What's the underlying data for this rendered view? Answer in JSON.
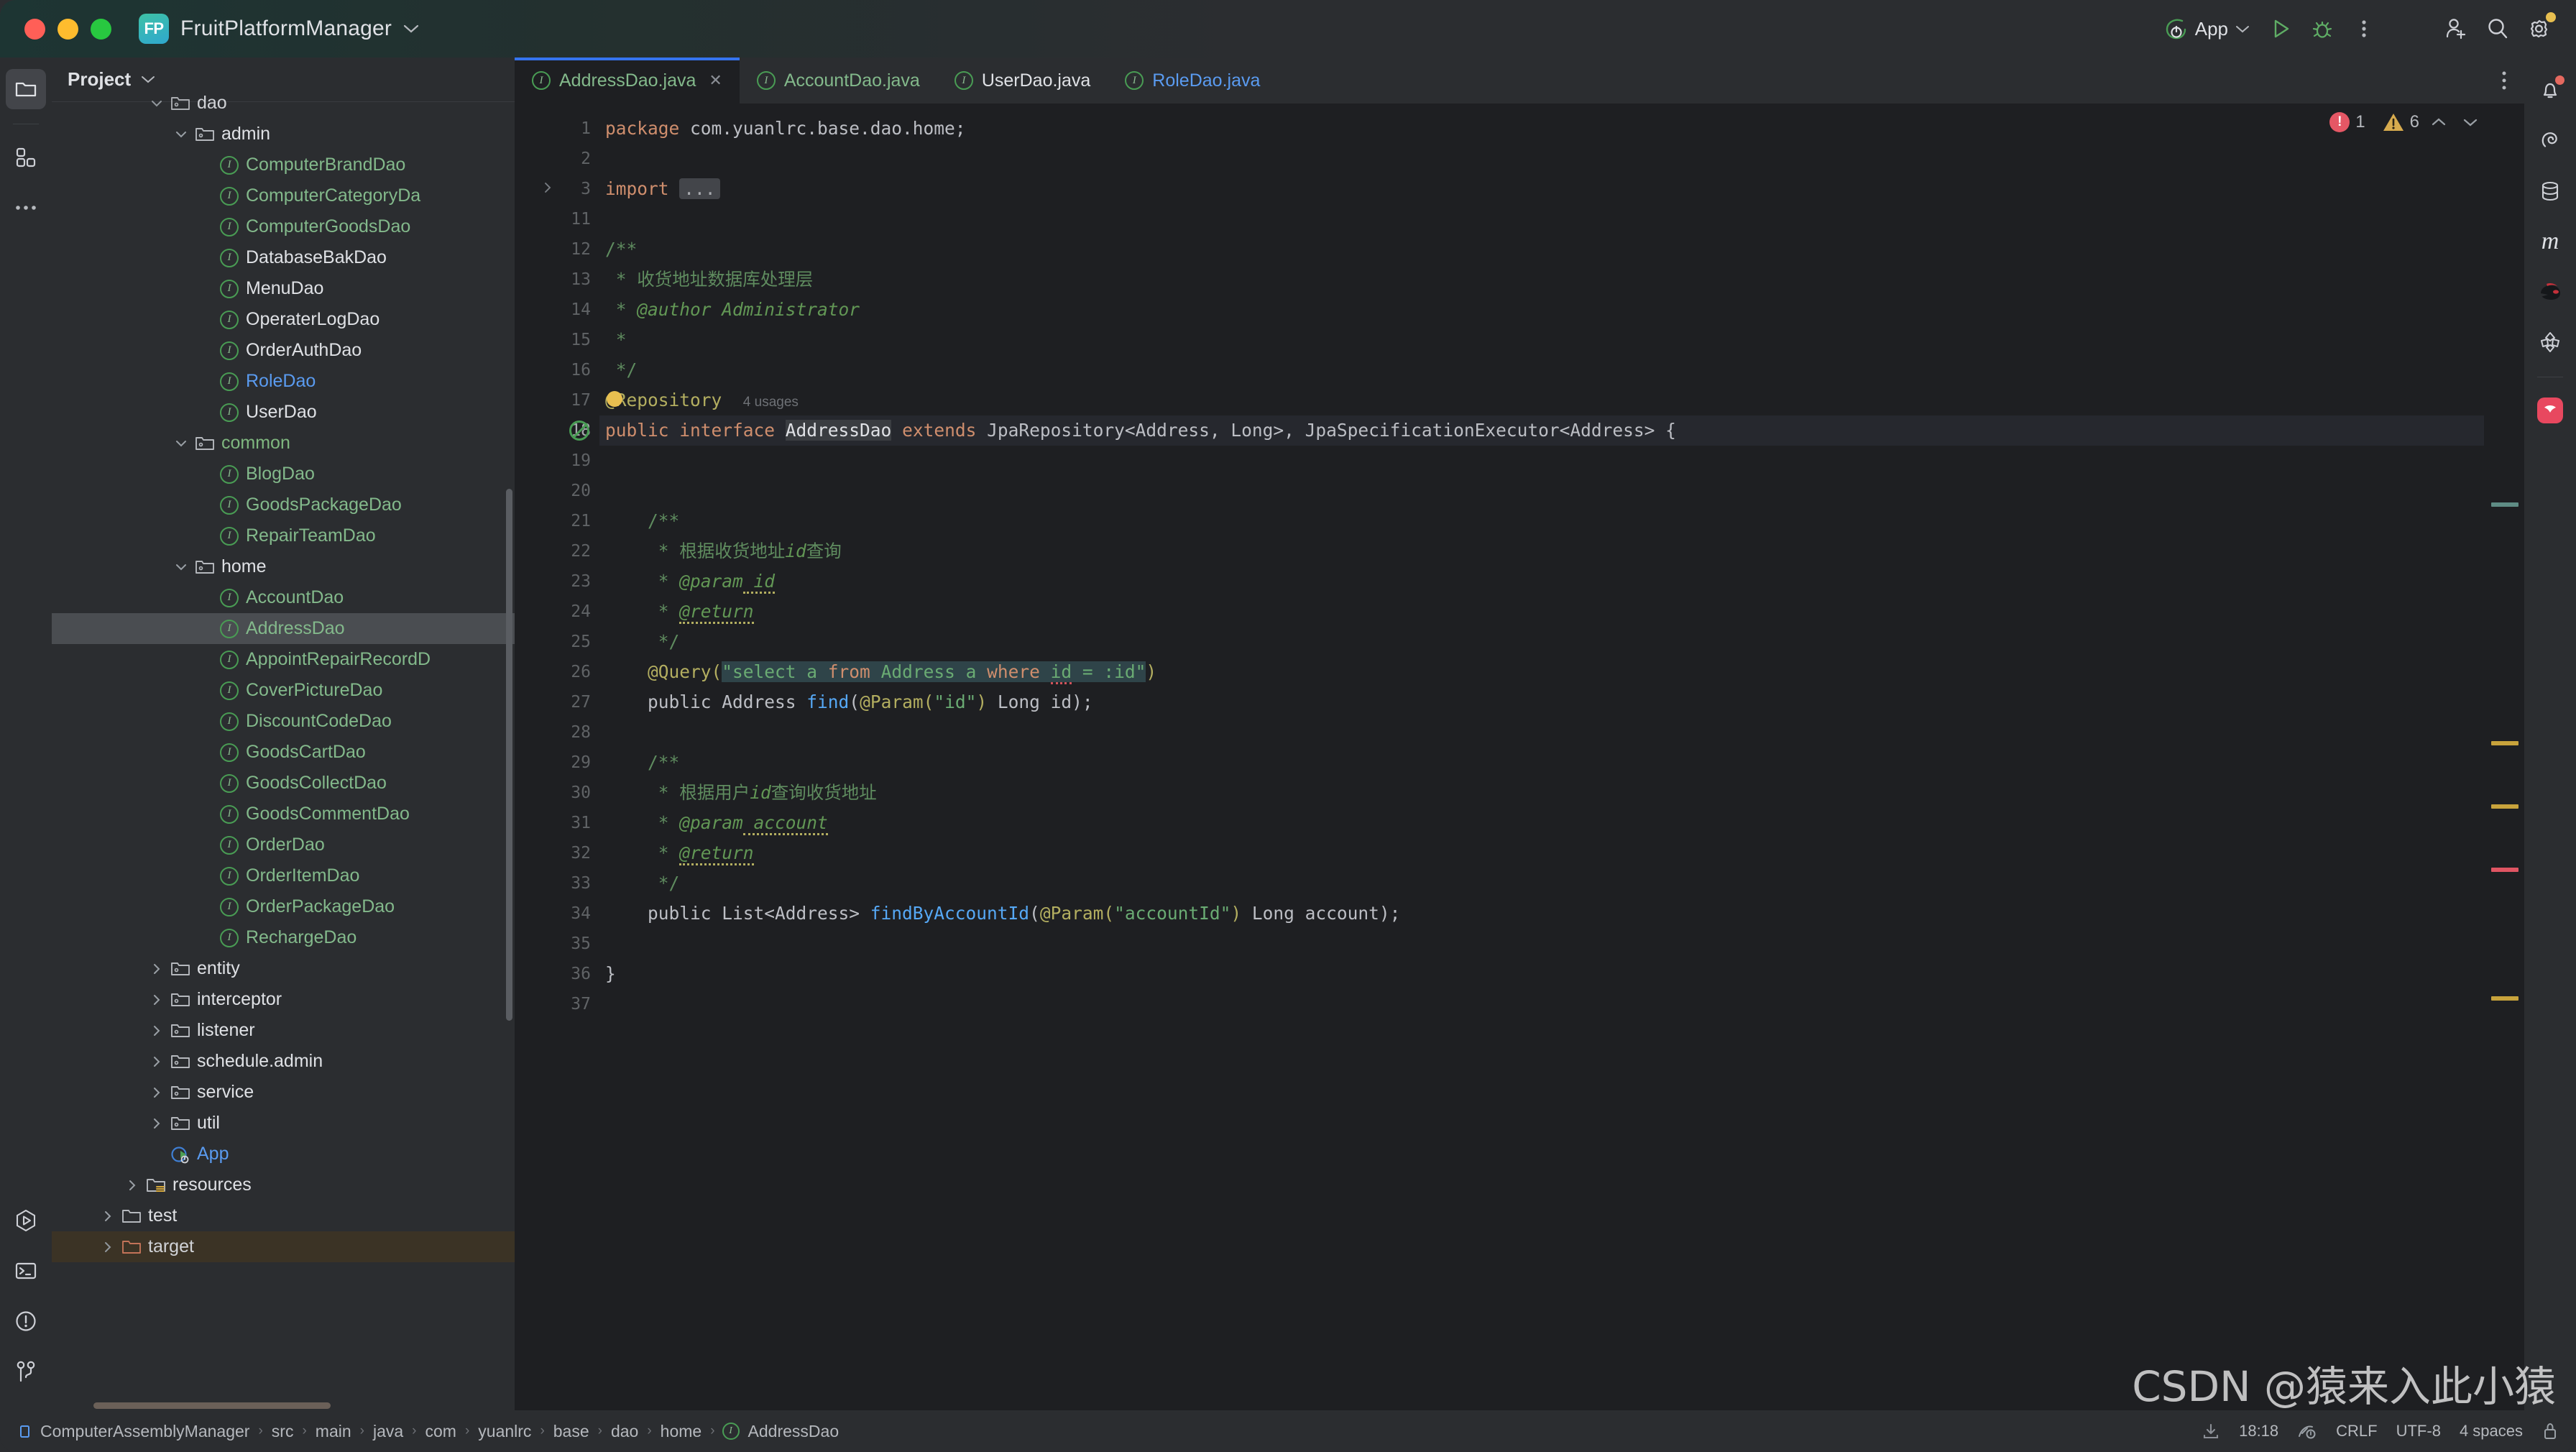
{
  "titlebar": {
    "project_initials": "FP",
    "project_name": "FruitPlatformManager",
    "dropdown_icon": "chevron-down-icon",
    "run_config_label": "App",
    "run_icon": "run-icon",
    "debug_icon": "debug-icon",
    "more_icon": "more-vertical-icon",
    "add_user_icon": "add-user-icon",
    "search_icon": "search-icon",
    "settings_icon": "gear-icon"
  },
  "left_rail": {
    "items": [
      {
        "name": "project-tool-window",
        "icon": "folder-icon",
        "active": true
      },
      {
        "name": "structure-tool-window",
        "icon": "blocks-icon",
        "active": false
      },
      {
        "name": "more-tool-windows",
        "icon": "ellipsis-icon",
        "active": false
      }
    ],
    "bottom_items": [
      {
        "name": "run-tool-window",
        "icon": "run-hex-icon"
      },
      {
        "name": "terminal-tool-window",
        "icon": "terminal-icon"
      },
      {
        "name": "problems-tool-window",
        "icon": "warning-circle-icon"
      },
      {
        "name": "version-control-tool-window",
        "icon": "git-branch-icon"
      }
    ]
  },
  "right_rail": {
    "items": [
      {
        "name": "notifications",
        "icon": "bell-icon",
        "badge": true
      },
      {
        "name": "spring-tool",
        "icon": "spiral-icon"
      },
      {
        "name": "database-tool",
        "icon": "database-icon"
      },
      {
        "name": "maven-tool",
        "icon": "maven-m-icon"
      },
      {
        "name": "ninja-tool",
        "icon": "ninja-icon"
      },
      {
        "name": "gradle-tool",
        "icon": "gradle-icon"
      },
      {
        "name": "ai-assistant",
        "icon": "assistant-icon"
      }
    ]
  },
  "project_panel": {
    "title": "Project",
    "dropdown_icon": "chevron-down-icon",
    "tree": [
      {
        "label": "dao",
        "type": "folder",
        "indent": 4,
        "twisty": "down",
        "color": "white",
        "clipped": true
      },
      {
        "label": "admin",
        "type": "folder-pkg",
        "indent": 5,
        "twisty": "down",
        "color": "white"
      },
      {
        "label": "ComputerBrandDao",
        "type": "interface",
        "indent": 6,
        "twisty": "none",
        "color": "green"
      },
      {
        "label": "ComputerCategoryDa",
        "type": "interface",
        "indent": 6,
        "twisty": "none",
        "color": "green"
      },
      {
        "label": "ComputerGoodsDao",
        "type": "interface",
        "indent": 6,
        "twisty": "none",
        "color": "green"
      },
      {
        "label": "DatabaseBakDao",
        "type": "interface",
        "indent": 6,
        "twisty": "none",
        "color": "white"
      },
      {
        "label": "MenuDao",
        "type": "interface",
        "indent": 6,
        "twisty": "none",
        "color": "white"
      },
      {
        "label": "OperaterLogDao",
        "type": "interface",
        "indent": 6,
        "twisty": "none",
        "color": "white"
      },
      {
        "label": "OrderAuthDao",
        "type": "interface",
        "indent": 6,
        "twisty": "none",
        "color": "white"
      },
      {
        "label": "RoleDao",
        "type": "interface",
        "indent": 6,
        "twisty": "none",
        "color": "blue"
      },
      {
        "label": "UserDao",
        "type": "interface",
        "indent": 6,
        "twisty": "none",
        "color": "white"
      },
      {
        "label": "common",
        "type": "folder-pkg",
        "indent": 5,
        "twisty": "down",
        "color": "folder-green"
      },
      {
        "label": "BlogDao",
        "type": "interface",
        "indent": 6,
        "twisty": "none",
        "color": "green"
      },
      {
        "label": "GoodsPackageDao",
        "type": "interface",
        "indent": 6,
        "twisty": "none",
        "color": "green"
      },
      {
        "label": "RepairTeamDao",
        "type": "interface",
        "indent": 6,
        "twisty": "none",
        "color": "green"
      },
      {
        "label": "home",
        "type": "folder-pkg",
        "indent": 5,
        "twisty": "down",
        "color": "white"
      },
      {
        "label": "AccountDao",
        "type": "interface",
        "indent": 6,
        "twisty": "none",
        "color": "green"
      },
      {
        "label": "AddressDao",
        "type": "interface",
        "indent": 6,
        "twisty": "none",
        "color": "green",
        "selected": true
      },
      {
        "label": "AppointRepairRecordD",
        "type": "interface",
        "indent": 6,
        "twisty": "none",
        "color": "green"
      },
      {
        "label": "CoverPictureDao",
        "type": "interface",
        "indent": 6,
        "twisty": "none",
        "color": "green"
      },
      {
        "label": "DiscountCodeDao",
        "type": "interface",
        "indent": 6,
        "twisty": "none",
        "color": "green"
      },
      {
        "label": "GoodsCartDao",
        "type": "interface",
        "indent": 6,
        "twisty": "none",
        "color": "green"
      },
      {
        "label": "GoodsCollectDao",
        "type": "interface",
        "indent": 6,
        "twisty": "none",
        "color": "green"
      },
      {
        "label": "GoodsCommentDao",
        "type": "interface",
        "indent": 6,
        "twisty": "none",
        "color": "green"
      },
      {
        "label": "OrderDao",
        "type": "interface",
        "indent": 6,
        "twisty": "none",
        "color": "green"
      },
      {
        "label": "OrderItemDao",
        "type": "interface",
        "indent": 6,
        "twisty": "none",
        "color": "green"
      },
      {
        "label": "OrderPackageDao",
        "type": "interface",
        "indent": 6,
        "twisty": "none",
        "color": "green"
      },
      {
        "label": "RechargeDao",
        "type": "interface",
        "indent": 6,
        "twisty": "none",
        "color": "green"
      },
      {
        "label": "entity",
        "type": "folder-pkg",
        "indent": 4,
        "twisty": "right",
        "color": "white"
      },
      {
        "label": "interceptor",
        "type": "folder-pkg",
        "indent": 4,
        "twisty": "right",
        "color": "white"
      },
      {
        "label": "listener",
        "type": "folder-pkg",
        "indent": 4,
        "twisty": "right",
        "color": "white"
      },
      {
        "label": "schedule.admin",
        "type": "folder-pkg",
        "indent": 4,
        "twisty": "right",
        "color": "white"
      },
      {
        "label": "service",
        "type": "folder-pkg",
        "indent": 4,
        "twisty": "right",
        "color": "white"
      },
      {
        "label": "util",
        "type": "folder-pkg",
        "indent": 4,
        "twisty": "right",
        "color": "white"
      },
      {
        "label": "App",
        "type": "spring-app",
        "indent": 4,
        "twisty": "none",
        "color": "blue"
      },
      {
        "label": "resources",
        "type": "folder-res",
        "indent": 3,
        "twisty": "right",
        "color": "white"
      },
      {
        "label": "test",
        "type": "folder-plain",
        "indent": 2,
        "twisty": "right",
        "color": "white"
      },
      {
        "label": "target",
        "type": "folder-target",
        "indent": 2,
        "twisty": "right",
        "color": "white",
        "highlight": true,
        "clipped": true
      }
    ]
  },
  "editor": {
    "tabs": [
      {
        "label": "AddressDao.java",
        "icon": "interface-icon",
        "color": "green",
        "active": true,
        "closable": true
      },
      {
        "label": "AccountDao.java",
        "icon": "interface-icon",
        "color": "green",
        "active": false,
        "closable": false
      },
      {
        "label": "UserDao.java",
        "icon": "interface-icon",
        "color": "white",
        "active": false,
        "closable": false
      },
      {
        "label": "RoleDao.java",
        "icon": "interface-icon",
        "color": "blue",
        "active": false,
        "closable": false
      }
    ],
    "tab_options_icon": "more-vertical-icon",
    "inspection": {
      "error_count": "1",
      "warning_count": "6",
      "prev_icon": "chevron-up-icon",
      "next_icon": "chevron-down-icon",
      "error_color": "#e55765",
      "warning_color": "#d7ab4e"
    },
    "line_numbers": [
      "1",
      "2",
      "3",
      "11",
      "12",
      "13",
      "14",
      "15",
      "16",
      "17",
      "18",
      "19",
      "20",
      "21",
      "22",
      "23",
      "24",
      "25",
      "26",
      "27",
      "28",
      "29",
      "30",
      "31",
      "32",
      "33",
      "34",
      "35",
      "36",
      "37"
    ],
    "current_line": "18",
    "usages_hint": "4 usages",
    "code_lines": [
      "package com.yuanlrc.base.dao.home;",
      "",
      "import ...",
      "",
      "/**",
      " * 收货地址数据库处理层",
      " * @author Administrator",
      " *",
      " */",
      "@Repository",
      "public interface AddressDao extends JpaRepository<Address, Long>, JpaSpecificationExecutor<Address> {",
      "",
      "",
      "    /**",
      "     * 根据收货地址id查询",
      "     * @param id",
      "     * @return",
      "     */",
      "    @Query(\"select a from Address a where id = :id\")",
      "    public Address find(@Param(\"id\") Long id);",
      "",
      "    /**",
      "     * 根据用户id查询收货地址",
      "     * @param account",
      "     * @return",
      "     */",
      "    public List<Address> findByAccountId(@Param(\"accountId\") Long account);",
      "",
      "}",
      ""
    ]
  },
  "statusbar": {
    "breadcrumbs": [
      "ComputerAssemblyManager",
      "src",
      "main",
      "java",
      "com",
      "yuanlrc",
      "base",
      "dao",
      "home",
      "AddressDao"
    ],
    "module_icon": "module-icon",
    "class_icon": "interface-icon",
    "download_icon": "download-icon",
    "time": "18:18",
    "inspection_icon": "inspection-eye-icon",
    "line_separator": "CRLF",
    "encoding": "UTF-8",
    "indent": "4 spaces",
    "lock_icon": "lock-icon"
  },
  "watermark": "CSDN @猿来入此小猿"
}
